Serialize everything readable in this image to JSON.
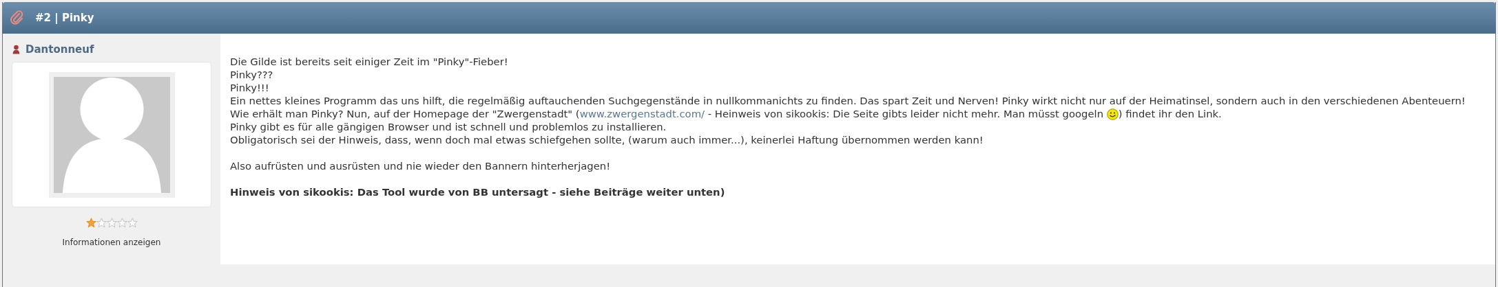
{
  "header": {
    "title": "#2 | Pinky"
  },
  "author": {
    "name": "Dantonneuf",
    "stars": 1,
    "info_link": "Informationen anzeigen"
  },
  "post": {
    "paragraphs": [
      [
        {
          "parts": [
            {
              "kind": "text",
              "text": "Die Gilde ist bereits seit einiger Zeit im \"Pinky\"-Fieber!"
            }
          ]
        },
        {
          "parts": [
            {
              "kind": "text",
              "text": "Pinky???"
            }
          ]
        },
        {
          "parts": [
            {
              "kind": "text",
              "text": "Pinky!!!"
            }
          ]
        },
        {
          "parts": [
            {
              "kind": "text",
              "text": "Ein nettes kleines Programm das uns hilft, die regelmäßig auftauchenden Suchgegenstände in nullkommanichts zu finden. Das spart Zeit und Nerven! Pinky wirkt nicht nur auf der Heimatinsel, sondern auch in den verschiedenen Abenteuern!"
            }
          ]
        },
        {
          "parts": [
            {
              "kind": "text",
              "text": "Wie erhält man Pinky? Nun, auf der Homepage der \"Zwergenstadt\" ("
            },
            {
              "kind": "link",
              "text": "www.zwergenstadt.com/"
            },
            {
              "kind": "text",
              "text": " - Heinweis von sikookis: Die Seite gibts leider nicht mehr. Man müsst googeln "
            },
            {
              "kind": "smiley"
            },
            {
              "kind": "text",
              "text": ") findet ihr den Link."
            }
          ]
        },
        {
          "parts": [
            {
              "kind": "text",
              "text": "Pinky gibt es für alle gängigen Browser und ist schnell und problemlos zu installieren."
            }
          ]
        },
        {
          "parts": [
            {
              "kind": "text",
              "text": "Obligatorisch sei der Hinweis, dass, wenn doch mal etwas schiefgehen sollte, (warum auch immer...), keinerlei Haftung übernommen werden kann!"
            }
          ]
        }
      ],
      [
        {
          "parts": [
            {
              "kind": "text",
              "text": "Also aufrüsten und ausrüsten und nie wieder den Bannern hinterherjagen!"
            }
          ]
        }
      ],
      [
        {
          "parts": [
            {
              "kind": "bold",
              "text": "Hinweis von sikookis: Das Tool wurde von BB untersagt - siehe Beiträge weiter unten)"
            }
          ]
        }
      ]
    ]
  }
}
